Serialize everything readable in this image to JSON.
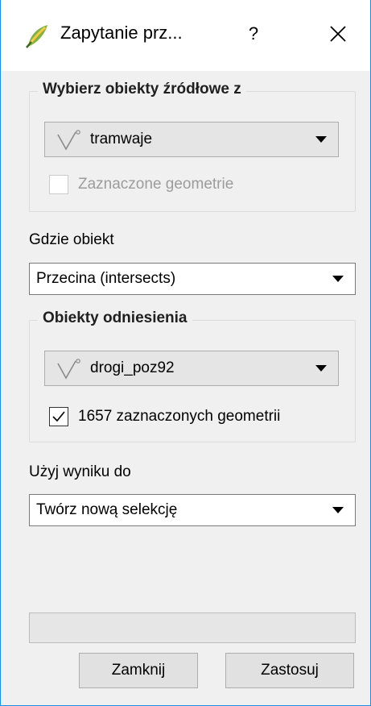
{
  "window": {
    "title": "Zapytanie prz...",
    "help_label": "?",
    "app_icon": "qgis-leaf-icon",
    "close_icon": "close-icon"
  },
  "source_group": {
    "title": "Wybierz obiekty źródłowe z",
    "layer_combo": {
      "value": "tramwaje",
      "icon": "line-layer-icon"
    },
    "selected_checkbox": {
      "label": "Zaznaczone geometrie",
      "checked": false,
      "enabled": false
    }
  },
  "where": {
    "label": "Gdzie obiekt",
    "predicate": "Przecina (intersects)"
  },
  "reference_group": {
    "title": "Obiekty odniesienia",
    "layer_combo": {
      "value": "drogi_poz92",
      "icon": "line-layer-icon"
    },
    "selected_checkbox": {
      "label": "1657 zaznaczonych geometrii",
      "checked": true,
      "enabled": true
    }
  },
  "result": {
    "label": "Użyj wyniku do",
    "action": "Twórz nową selekcję"
  },
  "buttons": {
    "close_label": "Zamknij",
    "apply_label": "Zastosuj"
  },
  "colors": {
    "window_border": "#1e8fe0",
    "dialog_bg": "#f0f0f0"
  }
}
